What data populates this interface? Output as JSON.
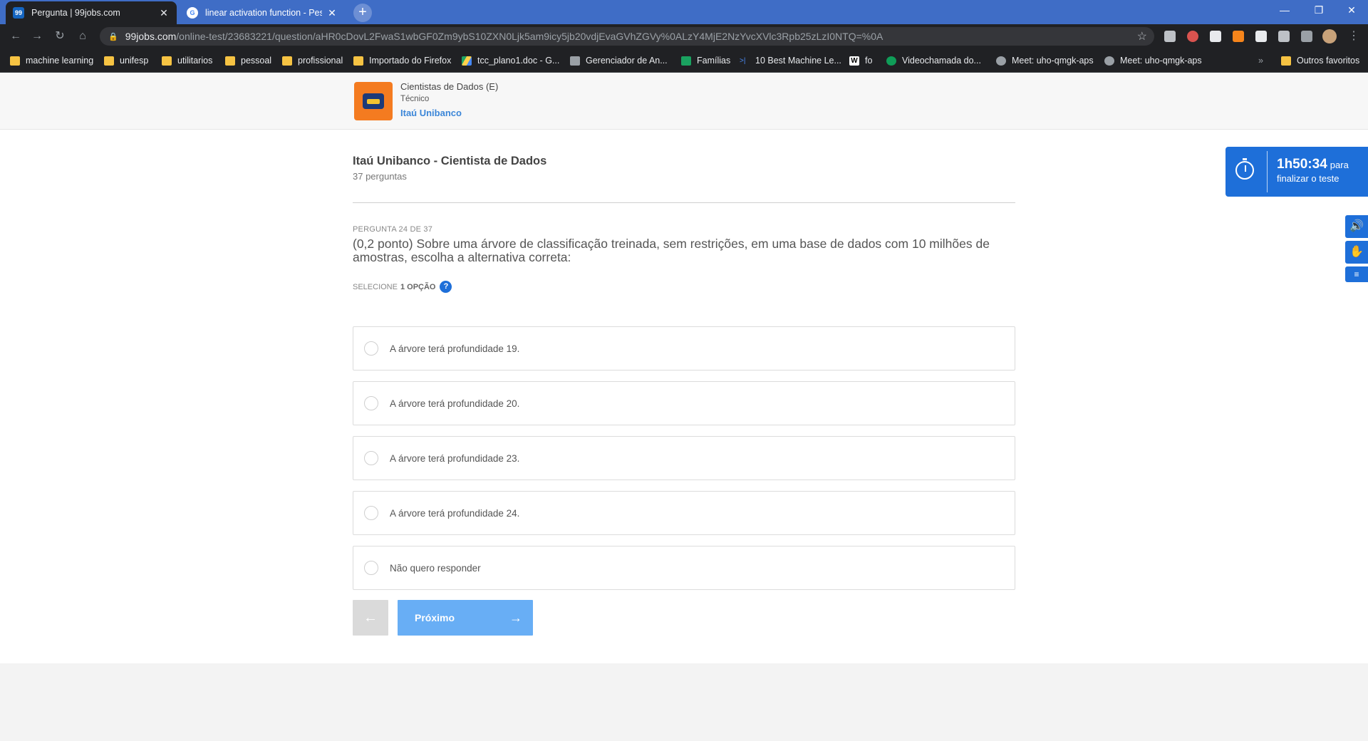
{
  "browser": {
    "tabs": [
      {
        "title": "Pergunta | 99jobs.com",
        "favicon": "99"
      },
      {
        "title": "linear activation function - Pesquisa Google",
        "favicon": "G"
      }
    ],
    "url_host": "99jobs.com",
    "url_path": "/online-test/23683221/question/aHR0cDovL2FwaS1wbGF0Zm9ybS10ZXN0Ljk5am9icy5jb20vdjEvaGVhZGVy%0ALzY4MjE2NzYvcXVlc3Rpb25zLzI0NTQ=%0A",
    "bookmarks": [
      {
        "label": "machine learning",
        "icon": "folder"
      },
      {
        "label": "unifesp",
        "icon": "folder"
      },
      {
        "label": "utilitarios",
        "icon": "folder"
      },
      {
        "label": "pessoal",
        "icon": "folder"
      },
      {
        "label": "profissional",
        "icon": "folder"
      },
      {
        "label": "Importado do Firefox",
        "icon": "folder"
      },
      {
        "label": "tcc_plano1.doc - G...",
        "icon": "drive-icon"
      },
      {
        "label": "Gerenciador de An...",
        "icon": "ads-icon"
      },
      {
        "label": "Famílias",
        "icon": "family-icon"
      },
      {
        "label": "10 Best Machine Le...",
        "icon": "link-icon"
      },
      {
        "label": "fo",
        "icon": "w-icon"
      },
      {
        "label": "Videochamada do...",
        "icon": "hangouts-icon"
      },
      {
        "label": "Meet: uho-qmgk-aps",
        "icon": "globe-icon"
      },
      {
        "label": "Meet: uho-qmgk-aps",
        "icon": "globe-icon"
      },
      {
        "label": "Outros favoritos",
        "icon": "folder"
      }
    ],
    "overflow_label": "»",
    "colors": {
      "tab_strip": "#3f6dc6",
      "toolbar": "#202124",
      "omnibox": "#35363a"
    }
  },
  "job": {
    "title": "Cientistas de Dados (E)",
    "level": "Técnico",
    "company": "Itaú Unibanco"
  },
  "test": {
    "title": "Itaú Unibanco - Cientista de Dados",
    "count": "37 perguntas"
  },
  "question": {
    "number": "PERGUNTA 24 DE 37",
    "text": "(0,2 ponto) Sobre uma árvore de classificação treinada, sem restrições, em uma base de dados com 10 milhões de amostras, escolha a alternativa correta:",
    "select_prefix": "SELECIONE",
    "select_count": "1 OPÇÃO",
    "help": "?"
  },
  "options": [
    "A árvore terá profundidade 19.",
    "A árvore terá profundidade 20.",
    "A árvore terá profundidade 23.",
    "A árvore terá profundidade 24.",
    "Não quero responder"
  ],
  "nav": {
    "back_icon": "←",
    "next_label": "Próximo",
    "next_icon": "→"
  },
  "timer": {
    "time": "1h50:34",
    "para": "para",
    "suffix": "finalizar o teste"
  },
  "theme": {
    "accent": "#1e6fd9",
    "next_button": "#68aef5",
    "logo_bg": "#f47b20"
  }
}
